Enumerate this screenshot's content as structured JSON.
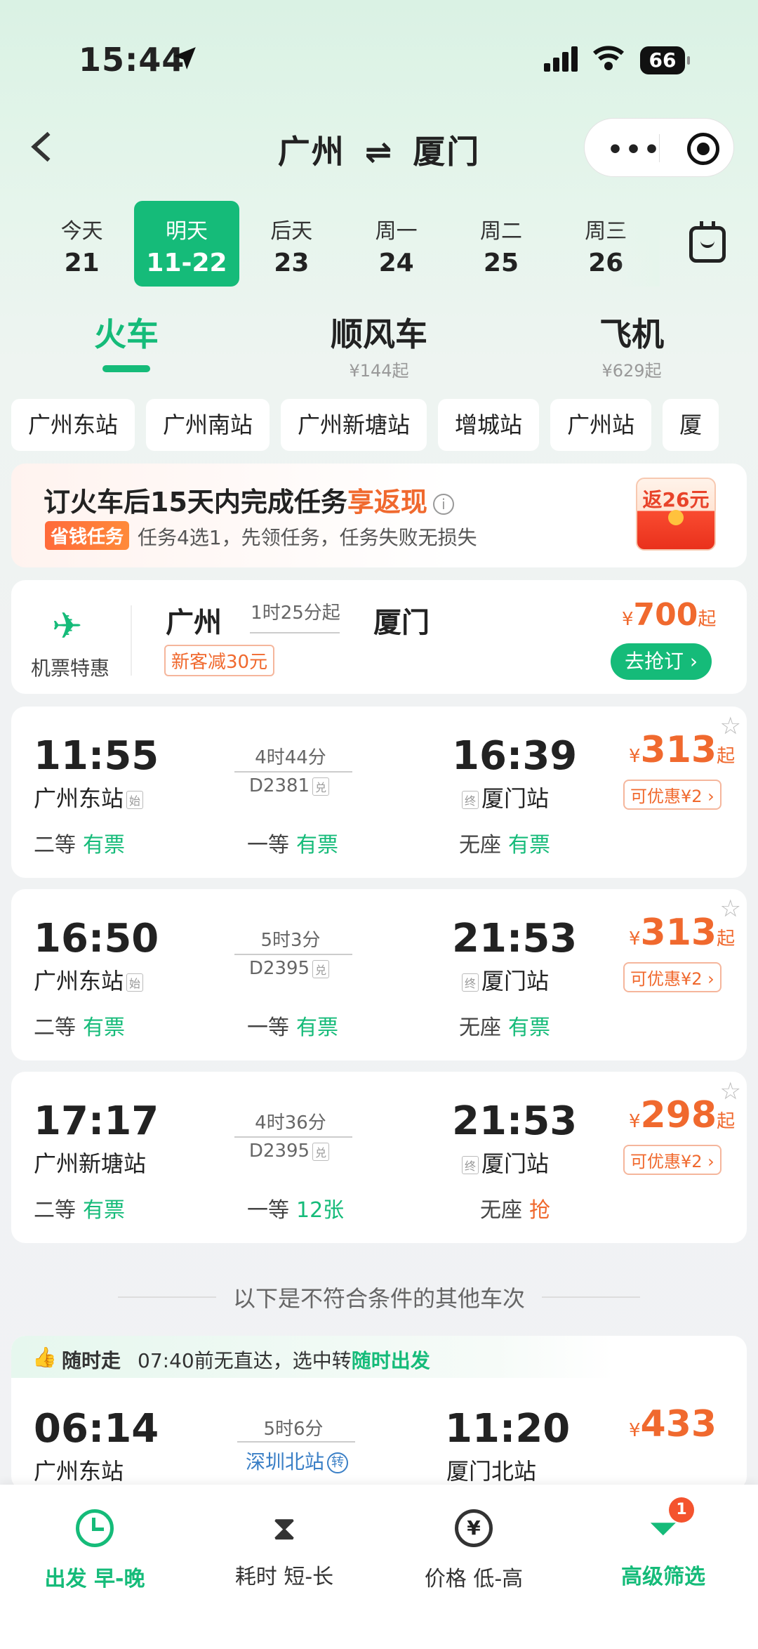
{
  "status": {
    "time": "15:44",
    "battery": "66"
  },
  "header": {
    "from": "广州",
    "arrow": "⇌",
    "to": "厦门"
  },
  "dates": [
    {
      "w": "今天",
      "d": "21"
    },
    {
      "w": "明天",
      "d": "11-22"
    },
    {
      "w": "后天",
      "d": "23"
    },
    {
      "w": "周一",
      "d": "24"
    },
    {
      "w": "周二",
      "d": "25"
    },
    {
      "w": "周三",
      "d": "26"
    }
  ],
  "modes": [
    {
      "t": "火车",
      "s": ""
    },
    {
      "t": "顺风车",
      "s": "¥144起"
    },
    {
      "t": "飞机",
      "s": "¥629起"
    }
  ],
  "stations": [
    "广州东站",
    "广州南站",
    "广州新塘站",
    "增城站",
    "广州站",
    "厦"
  ],
  "promo": {
    "title_a": "订火车后15天内完成任务",
    "title_b": "享返现",
    "tag": "省钱任务",
    "text": "任务4选1，先领任务，任务失败无损失",
    "envelope": "返26元"
  },
  "flight": {
    "label": "机票特惠",
    "from": "广州",
    "duration": "1时25分起",
    "to": "厦门",
    "discount": "新客减30元",
    "price_sym": "¥",
    "price": "700",
    "price_suffix": "起",
    "button": "去抢订 ›"
  },
  "trains": [
    {
      "dep": "11:55",
      "arr": "16:39",
      "dur": "4时44分",
      "num": "D2381",
      "from": "广州东站",
      "start_tag": "始",
      "to": "厦门站",
      "end_tag": "终",
      "price": "313",
      "coupon": "可优惠¥2 ›",
      "seats": [
        {
          "n": "二等",
          "v": "有票"
        },
        {
          "n": "一等",
          "v": "有票"
        },
        {
          "n": "无座",
          "v": "有票"
        }
      ]
    },
    {
      "dep": "16:50",
      "arr": "21:53",
      "dur": "5时3分",
      "num": "D2395",
      "from": "广州东站",
      "start_tag": "始",
      "to": "厦门站",
      "end_tag": "终",
      "price": "313",
      "coupon": "可优惠¥2 ›",
      "seats": [
        {
          "n": "二等",
          "v": "有票"
        },
        {
          "n": "一等",
          "v": "有票"
        },
        {
          "n": "无座",
          "v": "有票"
        }
      ]
    },
    {
      "dep": "17:17",
      "arr": "21:53",
      "dur": "4时36分",
      "num": "D2395",
      "from": "广州新塘站",
      "to": "厦门站",
      "end_tag": "终",
      "price": "298",
      "coupon": "可优惠¥2 ›",
      "seats": [
        {
          "n": "二等",
          "v": "有票"
        },
        {
          "n": "一等",
          "v": "12张"
        },
        {
          "n": "无座",
          "v": "抢"
        }
      ]
    }
  ],
  "ticket_mark": "兑",
  "price_sym": "¥",
  "price_suffix": "起",
  "other_title": "以下是不符合条件的其他车次",
  "transfer": {
    "label": "随时走",
    "msg": "07:40前无直达，选中转",
    "msg_hl": "随时出发",
    "dep": "06:14",
    "arr": "11:20",
    "dur": "5时6分",
    "via": "深圳北站",
    "via_tag": "转",
    "from": "广州东站",
    "to": "厦门北站",
    "price": "433"
  },
  "bottom": [
    {
      "lb": "出发 早-晚"
    },
    {
      "lb": "耗时 短-长"
    },
    {
      "lb": "价格 低-高"
    },
    {
      "lb": "高级筛选",
      "badge": "1"
    }
  ],
  "colors": {
    "accent": "#15bb79",
    "price": "#f0692e"
  }
}
